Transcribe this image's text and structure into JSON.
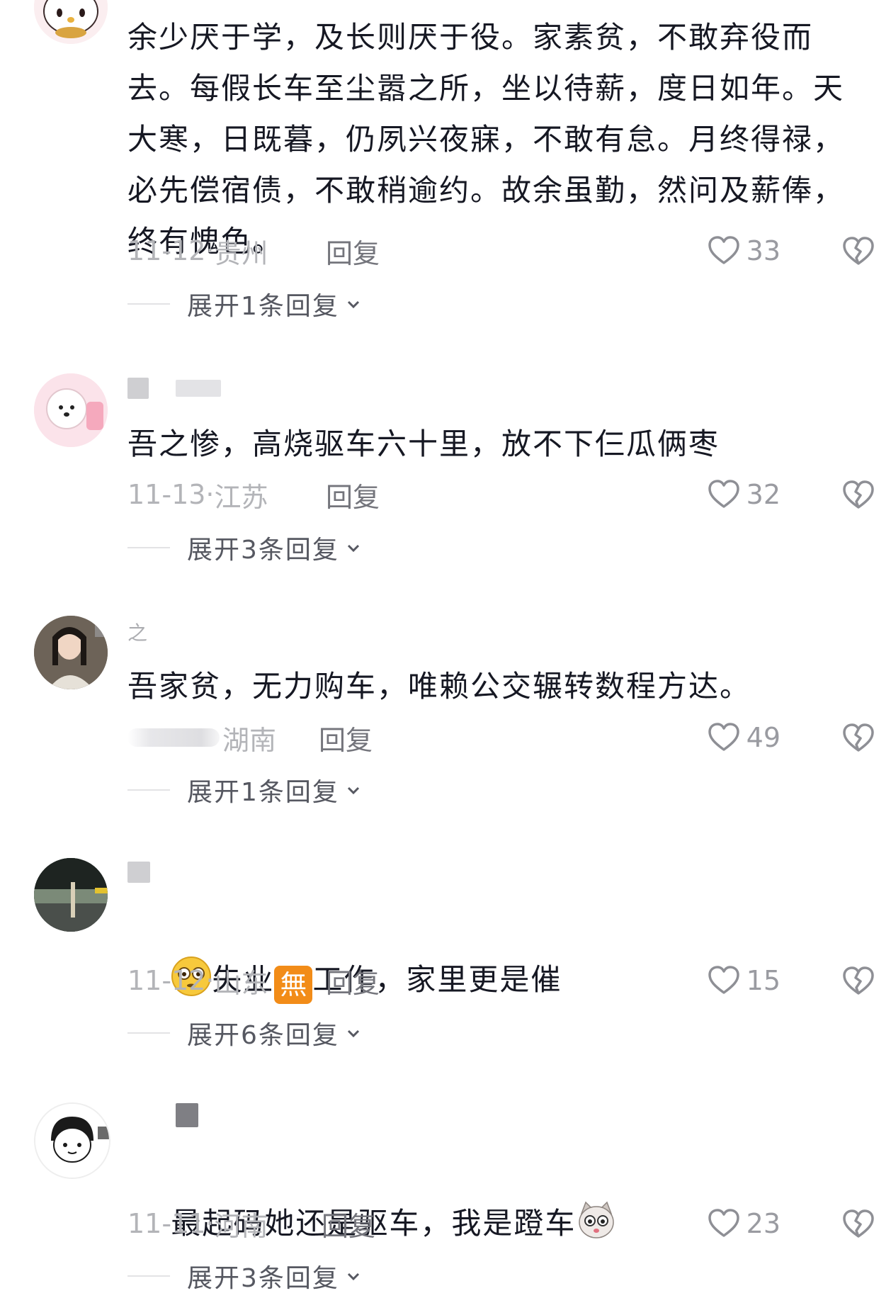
{
  "comments": [
    {
      "username": "",
      "text": "余少厌于学，及长则厌于役。家素贫，不敢弃役而去。每假长车至尘嚣之所，坐以待薪，度日如年。天大寒，日既暮，仍夙兴夜寐，不敢有怠。月终得禄，必先偿宿债，不敢稍逾约。故余虽勤，然问及薪俸，终有愧色。",
      "date": "11-12",
      "location": "贵州",
      "reply": "回复",
      "likes": "33",
      "expand": "展开1条回复"
    },
    {
      "username": "",
      "text": "吾之惨，高烧驱车六十里，放不下仨瓜俩枣",
      "date": "11-13",
      "location": "江苏",
      "reply": "回复",
      "likes": "32",
      "expand": "展开3条回复"
    },
    {
      "username": "之",
      "text": "吾家贫，无力购车，唯赖公交辗转数程方达。",
      "date": "",
      "location": "湖南",
      "reply": "回复",
      "likes": "49",
      "expand": "展开1条回复"
    },
    {
      "username": "",
      "text_parts": [
        "失业",
        "工作，家里更是催"
      ],
      "emoji_face_char": "😳",
      "emoji_wu_char": "無",
      "date": "11-12",
      "location": "山东",
      "reply": "回复",
      "likes": "15",
      "expand": "展开6条回复"
    },
    {
      "username": "",
      "text": "最起码她还是驱车，我是蹬车",
      "date": "11-11",
      "location": "河南",
      "reply": "回复",
      "likes": "23",
      "expand": "展开3条回复"
    }
  ],
  "icons": {
    "like": "heart-outline-icon",
    "dislike": "broken-heart-icon",
    "expand": "chevron-down-icon"
  },
  "colors": {
    "text": "#161823",
    "meta": "#b3b4b8",
    "reply": "#74757c",
    "expand": "#565861"
  }
}
